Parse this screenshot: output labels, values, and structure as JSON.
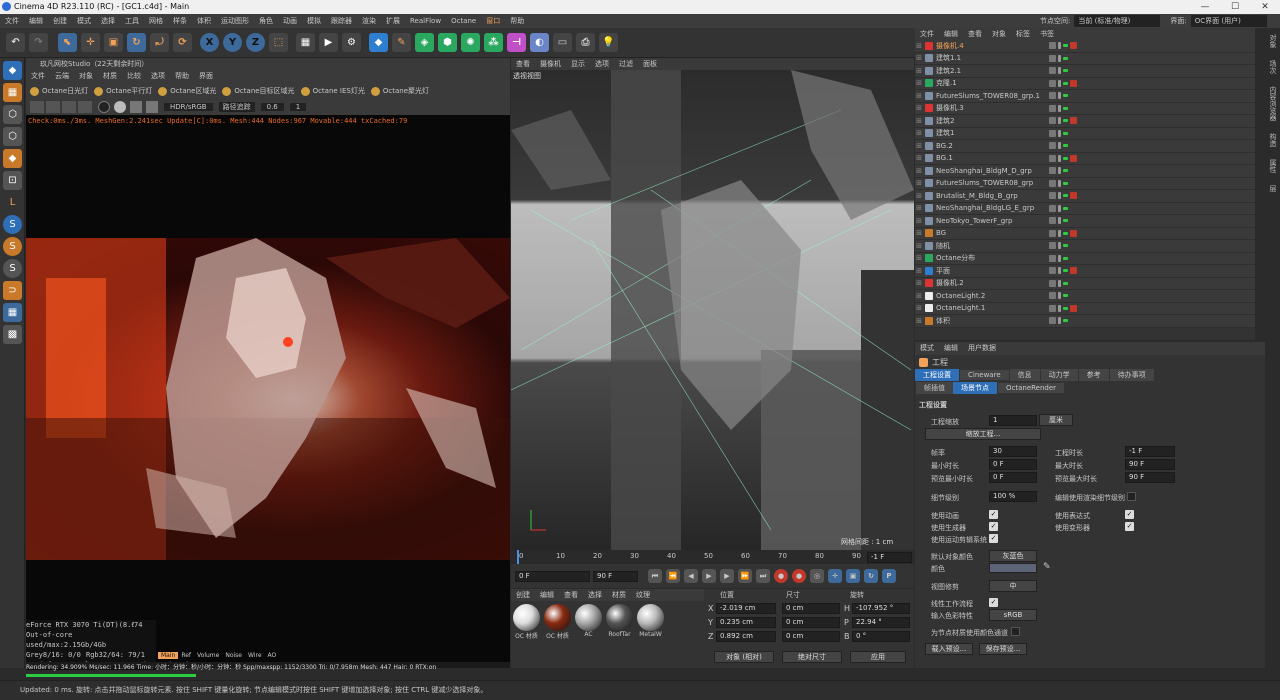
{
  "title": "Cinema 4D R23.110 (RC) - [GC1.c4d] - Main",
  "window": {
    "min": "—",
    "max": "☐",
    "close": "✕"
  },
  "menu": [
    "文件",
    "编辑",
    "创建",
    "模式",
    "选择",
    "工具",
    "网格",
    "样条",
    "体积",
    "运动图形",
    "角色",
    "动画",
    "模拟",
    "跟踪器",
    "渲染",
    "扩展",
    "RealFlow",
    "Octane",
    "窗口",
    "帮助"
  ],
  "menu_right": {
    "node_space_label": "节点空间:",
    "node_space_value": "当前 (标准/物理)",
    "ui_label": "界面:",
    "ui_value": "OC界面 (用户)"
  },
  "accent": "#f3a25a",
  "toolbar": {
    "x": "X",
    "y": "Y",
    "z": "Z"
  },
  "octane_panel": {
    "title": "玖凡网校Studio（22天剩余时间）",
    "menu": [
      "文件",
      "云端",
      "对象",
      "材质",
      "比较",
      "选项",
      "帮助",
      "界面"
    ],
    "lights": [
      "Octane日光灯",
      "Octane平行灯",
      "Octane区域光",
      "Octane目标区域光",
      "Octane IES灯光",
      "Octane聚光灯"
    ],
    "color_space": "HDR/sRGB",
    "trace_label": "路径追踪",
    "trace_value": "0.6",
    "trace_value2": "1",
    "status": "Check:0ms./3ms. MeshGen:2.241sec Update[C]:0ms. Mesh:444 Nodes:967 Movable:444 txCached:79",
    "gpu": "eForce RTX 3070 Ti(DT)(8.6)k98",
    "gpu_val": "74",
    "outofcore": "Out-of-core used/max:2.15Gb/4Gb",
    "grey": "Grey8/16: 0/0",
    "rgb": "Rgb32/64: 79/1",
    "vram": "Used/free/total vram: 4.464Gb/386Mb/8Gb",
    "render_tabs": [
      "Main",
      "Ref",
      "Volume",
      "Noise",
      "Wire",
      "AO"
    ],
    "rendering": "Rendering: 34.909%  Ms/sec: 11.966  Time: 小时：分钟：秒/小时：分钟：秒  Spp/maxspp: 1152/3300  Tri: 0/7.958m  Mesh: 447  Hair: 0  RTX:on"
  },
  "viewport": {
    "menu": [
      "查看",
      "摄像机",
      "显示",
      "选项",
      "过滤",
      "面板"
    ],
    "name": "透视视图",
    "grid": "网格间距 : 1 cm"
  },
  "timeline": {
    "ticks": [
      "0",
      "10",
      "20",
      "30",
      "40",
      "50",
      "60",
      "70",
      "80",
      "90"
    ],
    "end_frame": "-1 F",
    "current": "0 F",
    "max": "90 F"
  },
  "materials": {
    "menu": [
      "创建",
      "编辑",
      "查看",
      "选择",
      "材质",
      "纹理"
    ],
    "items": [
      {
        "name": "OC 材质",
        "color": "#ddd"
      },
      {
        "name": "OC 材质",
        "color": "#8a2a10"
      },
      {
        "name": "AC",
        "color": "#aaa"
      },
      {
        "name": "RoofTar",
        "color": "#555"
      },
      {
        "name": "MetalW",
        "color": "#bbb"
      }
    ]
  },
  "coords": {
    "headers": [
      "位置",
      "尺寸",
      "旋转"
    ],
    "rows": [
      {
        "axis": "X",
        "pos": "-2.019 cm",
        "size": "0 cm",
        "raxis": "H",
        "rot": "-107.952 °"
      },
      {
        "axis": "Y",
        "pos": "0.235 cm",
        "size": "0 cm",
        "raxis": "P",
        "rot": "22.94 °"
      },
      {
        "axis": "Z",
        "pos": "0.892 cm",
        "size": "0 cm",
        "raxis": "B",
        "rot": "0 °"
      }
    ],
    "mode": "对象 (相对)",
    "size_mode": "绝对尺寸",
    "apply": "应用"
  },
  "objects": {
    "menu": [
      "文件",
      "编辑",
      "查看",
      "对象",
      "标签",
      "书签"
    ],
    "items": [
      {
        "name": "摄像机.4",
        "hl": true
      },
      {
        "name": "建筑1.1"
      },
      {
        "name": "建筑2.1"
      },
      {
        "name": "克隆.1"
      },
      {
        "name": "FutureSlums_TOWER08_grp.1"
      },
      {
        "name": "摄像机.3"
      },
      {
        "name": "建筑2"
      },
      {
        "name": "建筑1"
      },
      {
        "name": "BG.2"
      },
      {
        "name": "BG.1"
      },
      {
        "name": "NeoShanghai_BldgM_D_grp"
      },
      {
        "name": "FutureSlums_TOWER08_grp"
      },
      {
        "name": "Brutalist_M_Bldg_B_grp"
      },
      {
        "name": "NeoShanghai_BldgLG_E_grp"
      },
      {
        "name": "NeoTokyo_TowerF_grp"
      },
      {
        "name": "BG"
      },
      {
        "name": "随机"
      },
      {
        "name": "Octane分布"
      },
      {
        "name": "平面"
      },
      {
        "name": "摄像机.2"
      },
      {
        "name": "OctaneLight.2"
      },
      {
        "name": "OctaneLight.1"
      },
      {
        "name": "体积"
      }
    ]
  },
  "side_tabs": [
    "对象",
    "场次",
    "内容浏览器",
    "构造",
    "属性",
    "层"
  ],
  "attributes": {
    "menu": [
      "模式",
      "编辑",
      "用户数据"
    ],
    "name": "工程",
    "tabs1": [
      "工程设置",
      "Cineware",
      "信息",
      "动力学",
      "参考",
      "待办事项"
    ],
    "tabs2": [
      "帧插值",
      "场景节点",
      "OctaneRender"
    ],
    "section": "工程设置",
    "scale_label": "工程缩放",
    "scale_value": "1",
    "scale_unit": "厘米",
    "scale_btn": "缩放工程...",
    "fps_label": "帧率",
    "fps": "30",
    "duration_label": "工程时长",
    "duration": "-1 F",
    "min_label": "最小时长",
    "min": "0 F",
    "max_label": "最大时长",
    "max": "90 F",
    "pmin_label": "预览最小时长",
    "pmin": "0 F",
    "pmax_label": "预览最大时长",
    "pmax": "90 F",
    "lod_label": "细节级别",
    "lod": "100 %",
    "lod_edit": "编辑使用渲染细节级别",
    "anim": "使用动画",
    "expr": "使用表达式",
    "gen": "使用生成器",
    "deform": "使用变形器",
    "motion": "使用运动剪辑系统",
    "color_label": "默认对象颜色",
    "color_value": "灰蓝色",
    "color2": "颜色",
    "clip_label": "视图修剪",
    "clip_value": "中",
    "linear": "线性工作流程",
    "input": "输入色彩特性",
    "input_value": "sRGB",
    "node_mat": "为节点材质使用颜色通道",
    "load": "载入预设...",
    "save": "保存预设..."
  },
  "statusbar": "Updated: 0 ms.  旋转: 点击并拖动鼠标旋转元素. 按住 SHIFT 键量化旋转; 节点编辑模式时按住 SHIFT 键增加选择对象; 按住 CTRL 键减少选择对象。"
}
